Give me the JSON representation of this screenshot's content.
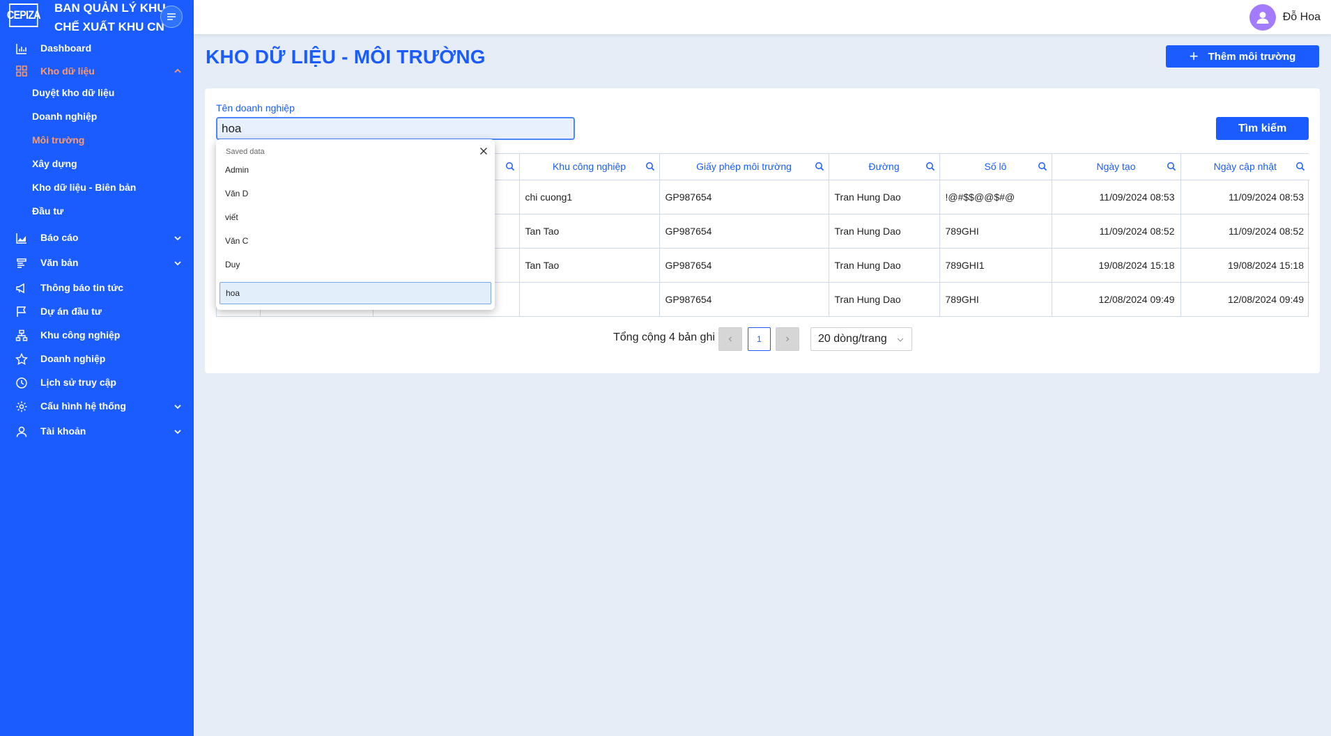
{
  "brand": {
    "logo": "CEPIZA",
    "title_line1": "BAN QUẢN LÝ KHU",
    "title_line2": "CHẾ XUẤT KHU CN"
  },
  "sidebar": {
    "items": [
      {
        "label": "Dashboard",
        "icon": "chart-bar-icon"
      },
      {
        "label": "Kho dữ liệu",
        "icon": "grid-icon",
        "expanded": true
      },
      {
        "label": "Báo cáo",
        "icon": "area-chart-icon"
      },
      {
        "label": "Văn bản",
        "icon": "document-icon"
      },
      {
        "label": "Thông báo tin tức",
        "icon": "megaphone-icon"
      },
      {
        "label": "Dự án đầu tư",
        "icon": "flag-icon"
      },
      {
        "label": "Khu công nghiệp",
        "icon": "sitemap-icon"
      },
      {
        "label": "Doanh nghiệp",
        "icon": "star-icon"
      },
      {
        "label": "Lịch sử truy cập",
        "icon": "clock-icon"
      },
      {
        "label": "Cấu hình hệ thống",
        "icon": "gear-icon"
      },
      {
        "label": "Tài khoản",
        "icon": "user-icon"
      }
    ],
    "subitems": [
      "Duyệt kho dữ liệu",
      "Doanh nghiệp",
      "Môi trường",
      "Xây dựng",
      "Kho dữ liệu - Biên bản",
      "Đầu tư"
    ],
    "active_color": "#ff9966"
  },
  "header": {
    "user_name": "Đỗ Hoa",
    "page_title": "KHO DỮ LIỆU - MÔI TRƯỜNG",
    "add_label": "Thêm môi trường"
  },
  "search": {
    "label": "Tên doanh nghiệp",
    "value": "hoa",
    "button": "Tìm kiếm"
  },
  "table": {
    "columns": [
      "Khu công nghiệp",
      "Giấy phép môi trường",
      "Đường",
      "Số lô",
      "Ngày tạo",
      "Ngày cập nhật"
    ],
    "rows": [
      [
        "chi cuong1",
        "GP987654",
        "Tran Hung Dao",
        "!@#$$@@$#@",
        "11/09/2024 08:53",
        "11/09/2024 08:53"
      ],
      [
        "Tan Tao",
        "GP987654",
        "Tran Hung Dao",
        "789GHI",
        "11/09/2024 08:52",
        "11/09/2024 08:52"
      ],
      [
        "Tan Tao",
        "GP987654",
        "Tran Hung Dao",
        "789GHI1",
        "19/08/2024 15:18",
        "19/08/2024 15:18"
      ],
      [
        "",
        "GP987654",
        "Tran Hung Dao",
        "789GHI",
        "12/08/2024 09:49",
        "12/08/2024 09:49"
      ]
    ]
  },
  "dropdown": {
    "header": "Saved data",
    "items": [
      "Admin",
      "Văn D",
      "viết",
      "Văn C",
      "Duy",
      "hoa"
    ],
    "selected": "hoa"
  },
  "pagination": {
    "total": "Tổng cộng 4 bản ghi",
    "current": "1",
    "page_size": "20 dòng/trang"
  },
  "colors": {
    "primary": "#1a5cff",
    "background": "#e6edf7"
  }
}
